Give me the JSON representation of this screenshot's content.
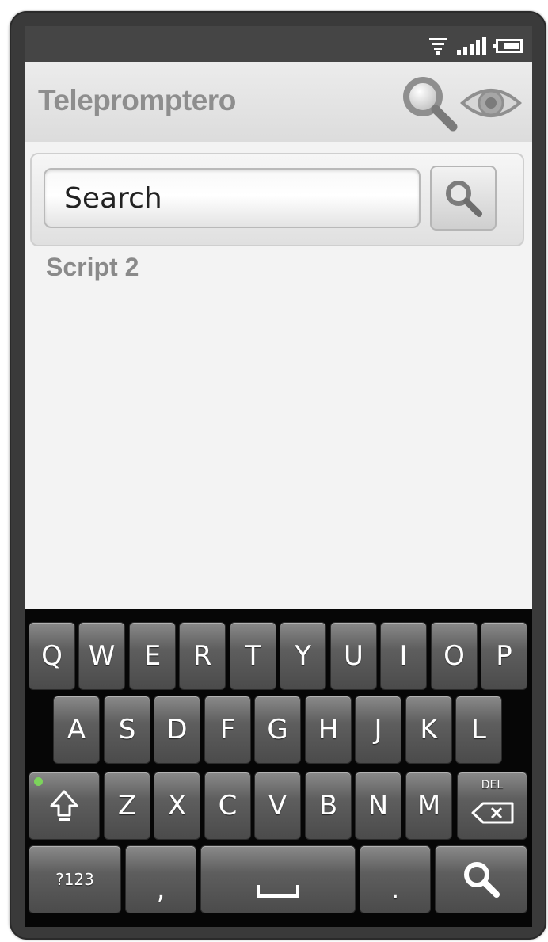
{
  "app": {
    "title": "Telepromptero"
  },
  "actions": {
    "search_icon": "magnifier-icon",
    "preview_icon": "eye-icon"
  },
  "search": {
    "placeholder": "Search",
    "button_icon": "magnifier-icon"
  },
  "list": {
    "items": [
      {
        "label": "Script 2"
      }
    ]
  },
  "keyboard": {
    "row1": [
      "Q",
      "W",
      "E",
      "R",
      "T",
      "Y",
      "U",
      "I",
      "O",
      "P"
    ],
    "row2": [
      "A",
      "S",
      "D",
      "F",
      "G",
      "H",
      "J",
      "K",
      "L"
    ],
    "row3": [
      "Z",
      "X",
      "C",
      "V",
      "B",
      "N",
      "M"
    ],
    "shift_icon": "shift-arrow-icon",
    "del_label": "DEL",
    "symbols_label": "?123",
    "comma_label": ",",
    "space_icon": "spacebar-icon",
    "period_label": ".",
    "search_key_icon": "magnifier-icon"
  },
  "colors": {
    "status_bar": "#454545",
    "action_bar": "#e2e2e2",
    "title": "#8e8e8e",
    "list_bg": "#f3f3f3",
    "keyboard_bg": "#060606",
    "shift_indicator": "#7cd35b"
  }
}
